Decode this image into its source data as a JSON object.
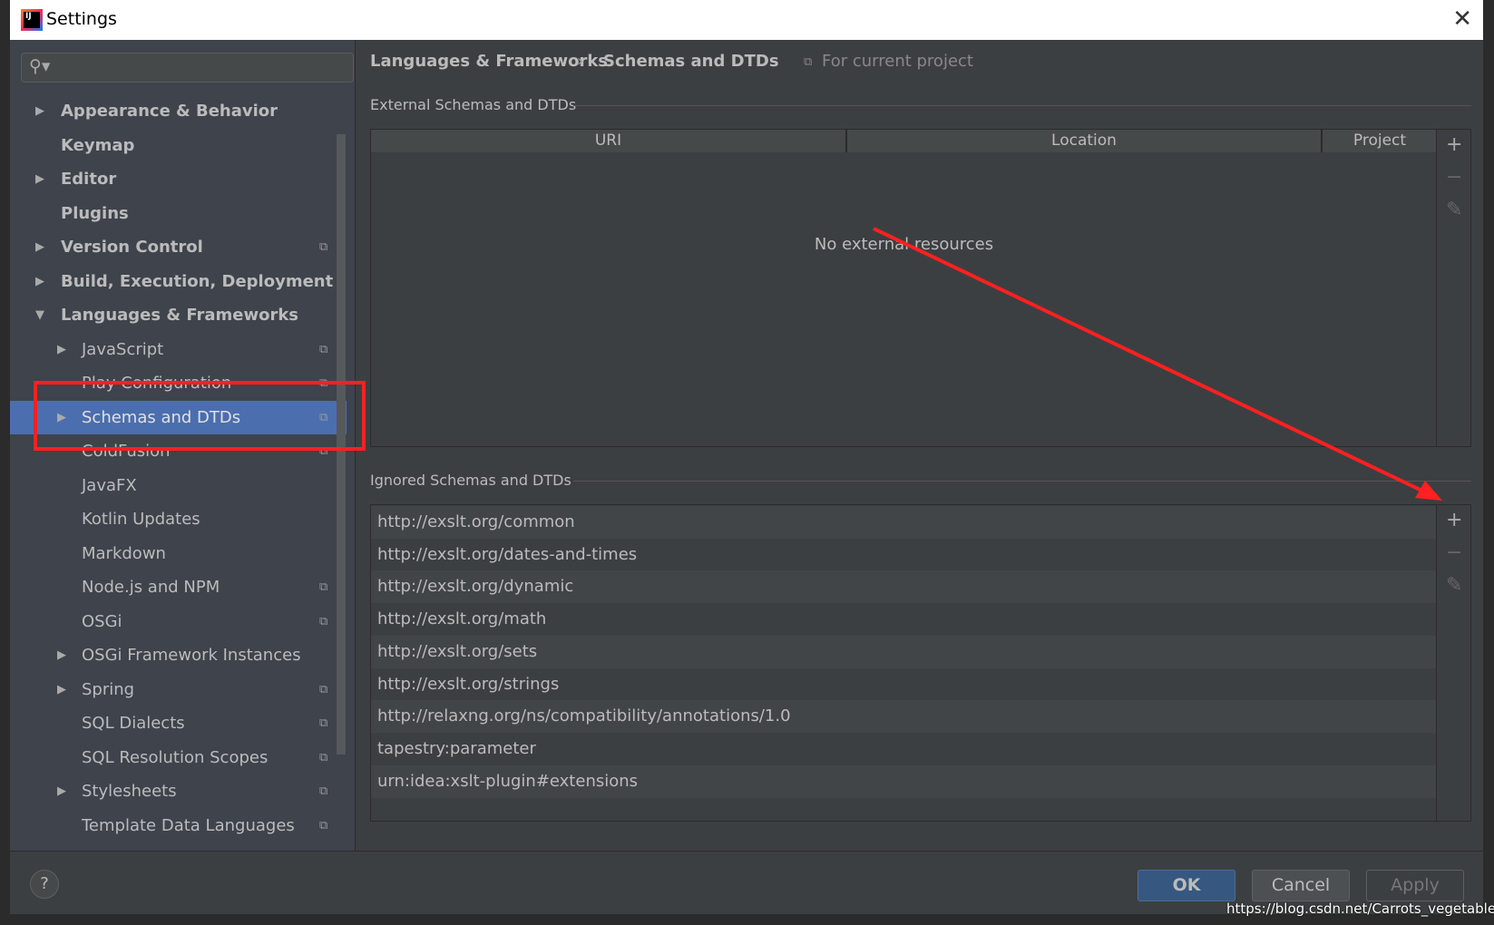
{
  "window": {
    "title": "Settings"
  },
  "search": {
    "placeholder": ""
  },
  "sidebar": {
    "items": [
      {
        "label": "Appearance & Behavior",
        "level": 0,
        "arrow": "right",
        "project": false
      },
      {
        "label": "Keymap",
        "level": 0,
        "arrow": "",
        "project": false
      },
      {
        "label": "Editor",
        "level": 0,
        "arrow": "right",
        "project": false
      },
      {
        "label": "Plugins",
        "level": 0,
        "arrow": "",
        "project": false
      },
      {
        "label": "Version Control",
        "level": 0,
        "arrow": "right",
        "project": true
      },
      {
        "label": "Build, Execution, Deployment",
        "level": 0,
        "arrow": "right",
        "project": false
      },
      {
        "label": "Languages & Frameworks",
        "level": 0,
        "arrow": "down",
        "project": false
      },
      {
        "label": "JavaScript",
        "level": 1,
        "arrow": "right",
        "project": true
      },
      {
        "label": "Play Configuration",
        "level": 1,
        "arrow": "",
        "project": true
      },
      {
        "label": "Schemas and DTDs",
        "level": 1,
        "arrow": "right",
        "project": true,
        "selected": true
      },
      {
        "label": "ColdFusion",
        "level": 1,
        "arrow": "",
        "project": true
      },
      {
        "label": "JavaFX",
        "level": 1,
        "arrow": "",
        "project": false
      },
      {
        "label": "Kotlin Updates",
        "level": 1,
        "arrow": "",
        "project": false
      },
      {
        "label": "Markdown",
        "level": 1,
        "arrow": "",
        "project": false
      },
      {
        "label": "Node.js and NPM",
        "level": 1,
        "arrow": "",
        "project": true
      },
      {
        "label": "OSGi",
        "level": 1,
        "arrow": "",
        "project": true
      },
      {
        "label": "OSGi Framework Instances",
        "level": 1,
        "arrow": "right",
        "project": false
      },
      {
        "label": "Spring",
        "level": 1,
        "arrow": "right",
        "project": true
      },
      {
        "label": "SQL Dialects",
        "level": 1,
        "arrow": "",
        "project": true
      },
      {
        "label": "SQL Resolution Scopes",
        "level": 1,
        "arrow": "",
        "project": true
      },
      {
        "label": "Stylesheets",
        "level": 1,
        "arrow": "right",
        "project": true
      },
      {
        "label": "Template Data Languages",
        "level": 1,
        "arrow": "",
        "project": true
      }
    ]
  },
  "breadcrumb": {
    "parent": "Languages & Frameworks",
    "separator": "›",
    "current": "Schemas and DTDs",
    "scope": "For current project"
  },
  "external": {
    "label": "External Schemas and DTDs",
    "columns": [
      "URI",
      "Location",
      "Project"
    ],
    "empty_text": "No external resources"
  },
  "ignored": {
    "label": "Ignored Schemas and DTDs",
    "rows": [
      "http://exslt.org/common",
      "http://exslt.org/dates-and-times",
      "http://exslt.org/dynamic",
      "http://exslt.org/math",
      "http://exslt.org/sets",
      "http://exslt.org/strings",
      "http://relaxng.org/ns/compatibility/annotations/1.0",
      "tapestry:parameter",
      "urn:idea:xslt-plugin#extensions"
    ]
  },
  "toolbar": {
    "add": "+",
    "remove": "−",
    "edit": "✎"
  },
  "buttons": {
    "help": "?",
    "ok": "OK",
    "cancel": "Cancel",
    "apply": "Apply"
  },
  "watermark": "https://blog.csdn.net/Carrots_vegetables",
  "colors": {
    "selection": "#4b6eaf",
    "annotation": "#ff2020",
    "background": "#3c3f41"
  }
}
